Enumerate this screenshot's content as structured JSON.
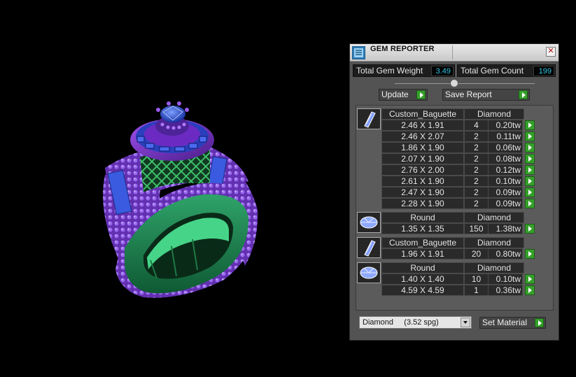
{
  "panel": {
    "title": "GEM REPORTER",
    "close_glyph": "✕",
    "total_weight_label": "Total Gem Weight",
    "total_weight_value": "3.49",
    "total_count_label": "Total Gem Count",
    "total_count_value": "199",
    "update_label": "Update",
    "save_label": "Save Report",
    "material_value": "Diamond     (3.52 spg)",
    "set_material_label": "Set Material"
  },
  "groups": [
    {
      "icon": "baguette-gem-icon",
      "shape": "Custom_Baguette",
      "material": "Diamond",
      "rows": [
        {
          "size": "2.46 X 1.91",
          "count": "4",
          "weight": "0.20tw"
        },
        {
          "size": "2.46 X 2.07",
          "count": "2",
          "weight": "0.11tw"
        },
        {
          "size": "1.86 X 1.90",
          "count": "2",
          "weight": "0.06tw"
        },
        {
          "size": "2.07 X 1.90",
          "count": "2",
          "weight": "0.08tw"
        },
        {
          "size": "2.76 X 2.00",
          "count": "2",
          "weight": "0.12tw"
        },
        {
          "size": "2.61 X 1.90",
          "count": "2",
          "weight": "0.10tw"
        },
        {
          "size": "2.47 X 1.90",
          "count": "2",
          "weight": "0.09tw"
        },
        {
          "size": "2.28 X 1.90",
          "count": "2",
          "weight": "0.09tw"
        }
      ]
    },
    {
      "icon": "round-gem-icon",
      "shape": "Round",
      "material": "Diamond",
      "rows": [
        {
          "size": "1.35 X 1.35",
          "count": "150",
          "weight": "1.38tw"
        }
      ]
    },
    {
      "icon": "baguette-gem-icon",
      "shape": "Custom_Baguette",
      "material": "Diamond",
      "rows": [
        {
          "size": "1.96 X 1.91",
          "count": "20",
          "weight": "0.80tw"
        }
      ]
    },
    {
      "icon": "round-gem-icon",
      "shape": "Round",
      "material": "Diamond",
      "rows": [
        {
          "size": "1.40 X 1.40",
          "count": "10",
          "weight": "0.10tw"
        },
        {
          "size": "4.59 X 4.59",
          "count": "1",
          "weight": "0.36tw"
        }
      ]
    }
  ],
  "colors": {
    "accent_green": "#35a02a",
    "value_cyan": "#32c8e6",
    "ring_band": "#2f9b5e",
    "ring_setting": "#7d32c8",
    "gem_blue": "#2f56d8"
  }
}
